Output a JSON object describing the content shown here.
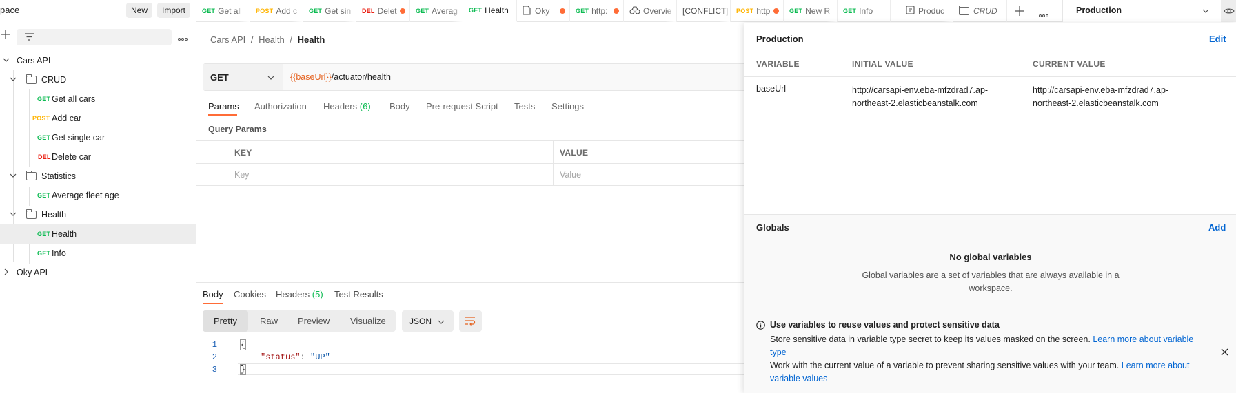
{
  "sidebar": {
    "workspace_title": "pace",
    "new_label": "New",
    "import_label": "Import",
    "collections": [
      {
        "name": "Cars API"
      },
      {
        "name": "Oky API"
      }
    ],
    "folders": {
      "crud": "CRUD",
      "statistics": "Statistics",
      "health": "Health"
    },
    "requests": {
      "get_all_cars": {
        "method": "GET",
        "name": "Get all cars"
      },
      "add_car": {
        "method": "POST",
        "name": "Add car"
      },
      "get_single_car": {
        "method": "GET",
        "name": "Get single car"
      },
      "delete_car": {
        "method": "DEL",
        "name": "Delete car"
      },
      "average_fleet_age": {
        "method": "GET",
        "name": "Average fleet age"
      },
      "health": {
        "method": "GET",
        "name": "Health"
      },
      "info": {
        "method": "GET",
        "name": "Info"
      }
    }
  },
  "tabs": [
    {
      "method": "GET",
      "label": "Get all"
    },
    {
      "method": "POST",
      "label": "Add c"
    },
    {
      "method": "GET",
      "label": "Get sin"
    },
    {
      "method": "DEL",
      "label": "Delet"
    },
    {
      "method": "GET",
      "label": "Averag"
    },
    {
      "method": "GET",
      "label": "Health"
    },
    {
      "method": "",
      "label": "Oky"
    },
    {
      "method": "GET",
      "label": "http:"
    },
    {
      "method": "",
      "label": "Overvie"
    },
    {
      "method": "",
      "label": "[CONFLICT]"
    },
    {
      "method": "POST",
      "label": "http"
    },
    {
      "method": "GET",
      "label": "New R"
    },
    {
      "method": "GET",
      "label": "Info"
    },
    {
      "method": "",
      "label": "Produc"
    },
    {
      "method": "",
      "label": "CRUD"
    }
  ],
  "environment": {
    "selected": "Production"
  },
  "request": {
    "breadcrumb": {
      "collection": "Cars API",
      "folder": "Health",
      "request": "Health"
    },
    "method": "GET",
    "url_var": "{{baseUrl}}",
    "url_path": "/actuator/health",
    "tabs": {
      "params": "Params",
      "authorization": "Authorization",
      "headers": "Headers",
      "headers_count": "(6)",
      "body": "Body",
      "prerequest": "Pre-request Script",
      "tests": "Tests",
      "settings": "Settings"
    },
    "query_params_title": "Query Params",
    "table": {
      "key_header": "KEY",
      "value_header": "VALUE",
      "key_placeholder": "Key",
      "value_placeholder": "Value"
    }
  },
  "response": {
    "tabs": {
      "body": "Body",
      "cookies": "Cookies",
      "headers": "Headers",
      "headers_count": "(5)",
      "tests": "Test Results"
    },
    "formats": {
      "pretty": "Pretty",
      "raw": "Raw",
      "preview": "Preview",
      "visualize": "Visualize"
    },
    "lang": "JSON",
    "code": {
      "l1": "1",
      "l2": "2",
      "l3": "3",
      "open": "{",
      "key": "\"status\"",
      "colon": ": ",
      "value": "\"UP\"",
      "close": "}"
    }
  },
  "env_panel": {
    "title": "Production",
    "edit_label": "Edit",
    "columns": {
      "variable": "VARIABLE",
      "initial": "INITIAL VALUE",
      "current": "CURRENT VALUE"
    },
    "variables": [
      {
        "name": "baseUrl",
        "initial_line1": "http://carsapi-env.eba-mfzdrad7.ap-",
        "initial_line2": "northeast-2.elasticbeanstalk.com",
        "current_line1": "http://carsapi-env.eba-mfzdrad7.ap-",
        "current_line2": "northeast-2.elasticbeanstalk.com"
      }
    ],
    "globals_title": "Globals",
    "add_label": "Add",
    "no_globals_title": "No global variables",
    "no_globals_line1": "Global variables are a set of variables that are always available in a",
    "no_globals_line2": "workspace.",
    "tip_title": "Use variables to reuse values and protect sensitive data",
    "tip_line1": "Store sensitive data in variable type secret to keep its values masked on the screen.",
    "tip_link1a": "Learn more about variable",
    "tip_link1b": "type",
    "tip_line2": "Work with the current value of a variable to prevent sharing sensitive values with your team.",
    "tip_link2a": "Learn more about",
    "tip_link2b": "variable values"
  }
}
